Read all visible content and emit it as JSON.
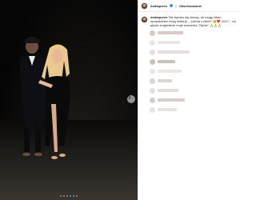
{
  "post": {
    "username": "dodaqueen",
    "follow_label": "Obserwowanie",
    "separator": "•",
    "caption_username": "dodaqueen",
    "caption_text": "Tak bardzo się cieszę, że mogę Wam opowiedzieć moją historię - „Ulecia z ziemi\" 🥳❤️ 2017... na płycie znajdziecie moje marzenia “Opole” 🙏🙏🙏"
  },
  "carousel": {
    "slide_count": 6,
    "active_index": 3
  },
  "comments_colors": [
    "#d8c9c6",
    "#ebe6e5",
    "#e9dde0",
    "#c9c2b9",
    "#eee6e4",
    "#dcd4d0",
    "#e6dcdb",
    "#d9cdc9",
    "#e9e2df"
  ],
  "accent": "#3897f0"
}
